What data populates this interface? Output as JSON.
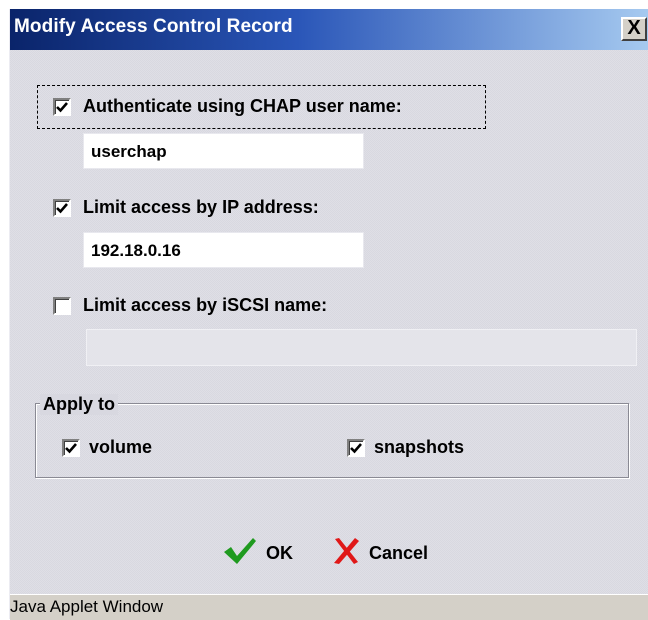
{
  "window": {
    "title": "Modify Access Control Record",
    "close_glyph": "X"
  },
  "chap": {
    "checked": true,
    "label": "Authenticate using CHAP user name:",
    "value": "userchap"
  },
  "ip": {
    "checked": true,
    "label": "Limit access by IP address:",
    "value": "192.18.0.16"
  },
  "iscsi": {
    "checked": false,
    "label": "Limit access by iSCSI name:",
    "value": ""
  },
  "apply_to": {
    "legend": "Apply to",
    "volume": {
      "checked": true,
      "label": "volume"
    },
    "snapshots": {
      "checked": true,
      "label": "snapshots"
    }
  },
  "buttons": {
    "ok": {
      "label": "OK",
      "icon": "checkmark-icon",
      "color": "#1f9a1f"
    },
    "cancel": {
      "label": "Cancel",
      "icon": "red-x-icon",
      "color": "#e01818"
    }
  },
  "statusbar": {
    "text": "Java Applet Window"
  },
  "colors": {
    "titlebar_start": "#0a246a",
    "titlebar_end": "#a6caf0",
    "dialog_bg": "#d8d8e0"
  }
}
